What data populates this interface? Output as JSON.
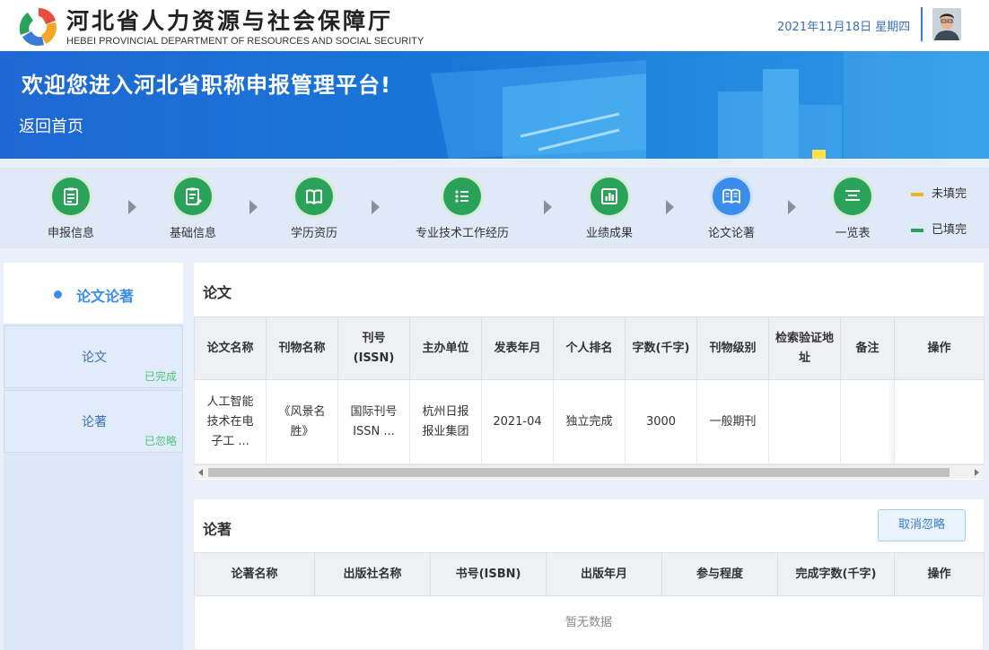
{
  "header": {
    "title_cn": "河北省人力资源与社会保障厅",
    "title_en": "HEBEI PROVINCIAL DEPARTMENT OF RESOURCES AND SOCIAL SECURITY",
    "date": "2021年11月18日 星期四"
  },
  "banner": {
    "welcome": "欢迎您进入河北省职称申报管理平台!",
    "back_home": "返回首页"
  },
  "steps": [
    {
      "label": "申报信息",
      "icon": "form-icon",
      "state": "done"
    },
    {
      "label": "基础信息",
      "icon": "edit-form-icon",
      "state": "done"
    },
    {
      "label": "学历资历",
      "icon": "book-icon",
      "state": "done"
    },
    {
      "label": "专业技术工作经历",
      "icon": "list-icon",
      "state": "done"
    },
    {
      "label": "业绩成果",
      "icon": "chart-icon",
      "state": "done"
    },
    {
      "label": "论文论著",
      "icon": "open-book-icon",
      "state": "current"
    },
    {
      "label": "一览表",
      "icon": "summary-icon",
      "state": "done"
    }
  ],
  "legend": {
    "unfilled": "未填完",
    "filled": "已填完",
    "unfilled_color": "#f0b429",
    "filled_color": "#2ba25a"
  },
  "sidebar": {
    "title": "论文论著",
    "items": [
      {
        "name": "论文",
        "status": "已完成"
      },
      {
        "name": "论著",
        "status": "已忽略"
      }
    ]
  },
  "papers": {
    "title": "论文",
    "columns": [
      "论文名称",
      "刊物名称",
      "刊号(ISSN)",
      "主办单位",
      "发表年月",
      "个人排名",
      "字数(千字)",
      "刊物级别",
      "检索验证地址",
      "备注",
      "操作"
    ],
    "rows": [
      {
        "name": "人工智能技术在电子工 ...",
        "journal": "《风景名胜》",
        "issn": "国际刊号 ISSN ...",
        "sponsor": "杭州日报报业集团",
        "date": "2021-04",
        "rank": "独立完成",
        "words": "3000",
        "level": "一般期刊",
        "verify": "",
        "remark": "",
        "ops": ""
      }
    ]
  },
  "books": {
    "title": "论著",
    "cancel_ignore": "取消忽略",
    "columns": [
      "论著名称",
      "出版社名称",
      "书号(ISBN)",
      "出版年月",
      "参与程度",
      "完成字数(千字)",
      "操作"
    ],
    "empty": "暂无数据"
  },
  "colors": {
    "primary": "#3b8ded",
    "done_green": "#2ba25a",
    "banner_blue": "#1f68d3"
  }
}
